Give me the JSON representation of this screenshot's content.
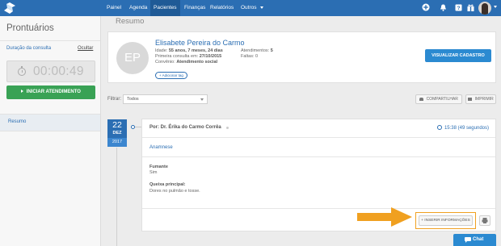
{
  "topnav": {
    "items": [
      "Painel",
      "Agenda",
      "Pacientes",
      "Finanças",
      "Relatórios",
      "Outros"
    ],
    "active": "Pacientes"
  },
  "sidebar": {
    "title": "Prontuários",
    "duration_label": "Duração da consulta",
    "hide_link": "Ocultar",
    "timer": "00:00:49",
    "start_button": "INICIAR ATENDIMENTO",
    "nav_item": "Resumo"
  },
  "main": {
    "page_title": "Resumo",
    "patient": {
      "initials": "EP",
      "name": "Elisabete Pereira do Carmo",
      "age_label": "Idade:",
      "age_value": "55 anos, 7 meses, 24 dias",
      "first_visit_label": "Primeira consulta em:",
      "first_visit_value": "27/10/2015",
      "insurance_label": "Convênio:",
      "insurance_value": "Atendimento social",
      "visits_label": "Atendimentos:",
      "visits_value": "5",
      "absences_label": "Faltas:",
      "absences_value": "0",
      "add_tag": "+ Adicionar tag",
      "view_button": "VISUALIZAR CADASTRO"
    },
    "filter": {
      "label": "Filtrar:",
      "value": "Todos"
    },
    "share_button": "COMPARTILHAR",
    "print_button": "IMPRIMIR",
    "timeline": {
      "date": {
        "day": "22",
        "month": "DEZ",
        "year": "2017"
      },
      "entry": {
        "author": "Por: Dr. Érika do Carmo Corrêa",
        "time": "15:38 (49 segundos)",
        "tab": "Anamnese",
        "fields": [
          {
            "label": "Fumante",
            "value": "Sim"
          },
          {
            "label": "Queixa principal:",
            "value": "Dores no pulmão e tosse."
          }
        ],
        "insert_button": "+ INSERIR INFORMAÇÕES"
      }
    }
  },
  "chat_button": "Chat",
  "colors": {
    "primary": "#2b6eb3",
    "button_blue": "#2b8ad1",
    "start_green": "#39a255",
    "highlight_orange": "#f0a020"
  }
}
